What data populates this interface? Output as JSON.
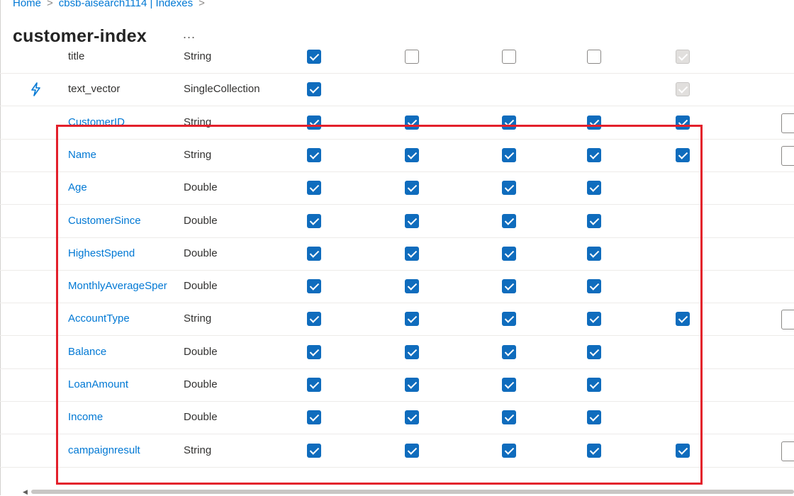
{
  "breadcrumb": {
    "items": [
      "Home",
      "cbsb-aisearch1114 | Indexes"
    ],
    "separator": ">"
  },
  "page": {
    "title": "customer-index",
    "more_label": "..."
  },
  "colors": {
    "accent": "#0f6cbd",
    "link": "#0078d4",
    "highlight": "#e3202b"
  },
  "fields": [
    {
      "name": "title",
      "type": "String",
      "link": false,
      "icon": "",
      "checks": [
        "on",
        "off",
        "off",
        "off",
        "dis"
      ],
      "edge": false
    },
    {
      "name": "text_vector",
      "type": "SingleCollection",
      "link": false,
      "icon": "lightning-icon",
      "checks": [
        "on",
        "none",
        "none",
        "none",
        "dis"
      ],
      "edge": false
    },
    {
      "name": "CustomerID",
      "type": "String",
      "link": true,
      "icon": "",
      "checks": [
        "on",
        "on",
        "on",
        "on",
        "on"
      ],
      "edge": true
    },
    {
      "name": "Name",
      "type": "String",
      "link": true,
      "icon": "",
      "checks": [
        "on",
        "on",
        "on",
        "on",
        "on"
      ],
      "edge": true
    },
    {
      "name": "Age",
      "type": "Double",
      "link": true,
      "icon": "",
      "checks": [
        "on",
        "on",
        "on",
        "on",
        "none"
      ],
      "edge": false
    },
    {
      "name": "CustomerSince",
      "type": "Double",
      "link": true,
      "icon": "",
      "checks": [
        "on",
        "on",
        "on",
        "on",
        "none"
      ],
      "edge": false
    },
    {
      "name": "HighestSpend",
      "type": "Double",
      "link": true,
      "icon": "",
      "checks": [
        "on",
        "on",
        "on",
        "on",
        "none"
      ],
      "edge": false
    },
    {
      "name": "MonthlyAverageSper",
      "type": "Double",
      "link": true,
      "icon": "",
      "checks": [
        "on",
        "on",
        "on",
        "on",
        "none"
      ],
      "edge": false
    },
    {
      "name": "AccountType",
      "type": "String",
      "link": true,
      "icon": "",
      "checks": [
        "on",
        "on",
        "on",
        "on",
        "on"
      ],
      "edge": true
    },
    {
      "name": "Balance",
      "type": "Double",
      "link": true,
      "icon": "",
      "checks": [
        "on",
        "on",
        "on",
        "on",
        "none"
      ],
      "edge": false
    },
    {
      "name": "LoanAmount",
      "type": "Double",
      "link": true,
      "icon": "",
      "checks": [
        "on",
        "on",
        "on",
        "on",
        "none"
      ],
      "edge": false
    },
    {
      "name": "Income",
      "type": "Double",
      "link": true,
      "icon": "",
      "checks": [
        "on",
        "on",
        "on",
        "on",
        "none"
      ],
      "edge": false
    },
    {
      "name": "campaignresult",
      "type": "String",
      "link": true,
      "icon": "",
      "checks": [
        "on",
        "on",
        "on",
        "on",
        "on"
      ],
      "edge": true
    }
  ]
}
